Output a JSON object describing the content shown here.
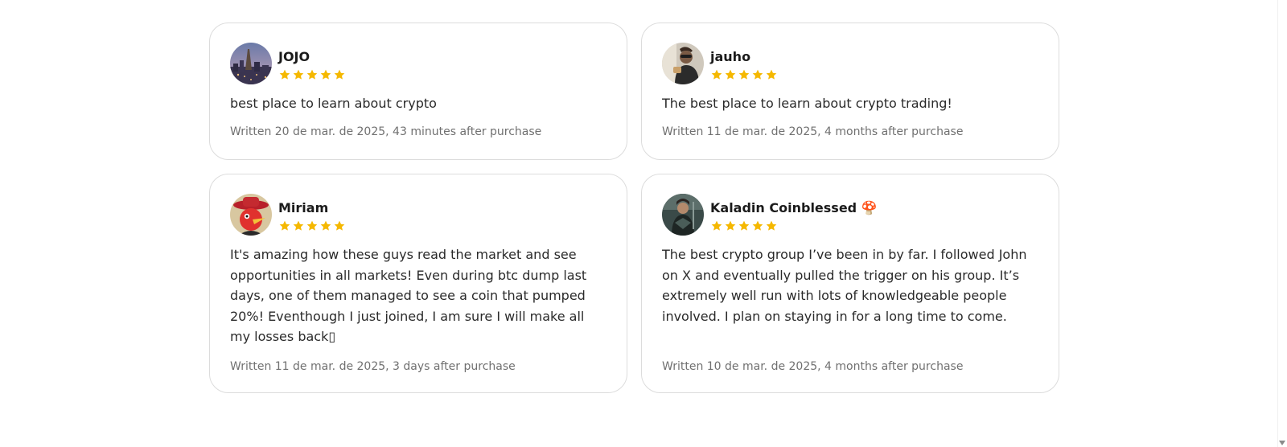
{
  "star_color": "#f5b800",
  "reviews": [
    {
      "name": "JOJO",
      "avatar_icon": "city-avatar-icon",
      "rating": 5,
      "text": "best place to learn about crypto",
      "written": "Written 20 de mar. de 2025, 43 minutes after purchase"
    },
    {
      "name": "jauho",
      "avatar_icon": "person-avatar-icon",
      "rating": 5,
      "text": "The best place to learn about crypto trading!",
      "written": "Written 11 de mar. de 2025, 4 months after purchase"
    },
    {
      "name": "Miriam",
      "avatar_icon": "cartoon-bird-avatar-icon",
      "rating": 5,
      "text": "It's amazing how these guys read the market and see opportunities in all markets! Even during btc dump last days, one of them managed to see a coin that pumped 20%! Eventhough I just joined, I am sure I will make all my losses back▯",
      "written": "Written 11 de mar. de 2025, 3 days after purchase"
    },
    {
      "name": "Kaladin Coinblessed 🍄",
      "avatar_icon": "warrior-avatar-icon",
      "rating": 5,
      "text": "The best crypto group I’ve been in by far. I followed John on X and eventually pulled the trigger on his group. It’s extremely well run with lots of knowledgeable people involved. I plan on staying in for a long time to come.",
      "written": "Written 10 de mar. de 2025, 4 months after purchase"
    }
  ]
}
